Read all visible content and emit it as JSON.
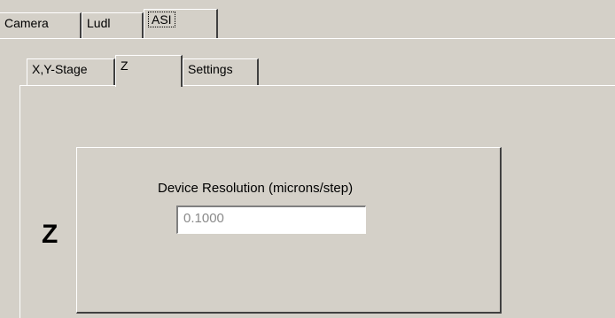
{
  "top_tabs": [
    {
      "label": "Camera"
    },
    {
      "label": "Ludl"
    },
    {
      "label": "ASI",
      "selected": true
    }
  ],
  "sub_tabs": [
    {
      "label": "X,Y-Stage"
    },
    {
      "label": "Z",
      "selected": true
    },
    {
      "label": "Settings"
    }
  ],
  "z_panel": {
    "axis_label": "Z",
    "resolution_label": "Device Resolution (microns/step)",
    "resolution_value": "0.1000"
  },
  "colors": {
    "background": "#d4d0c8",
    "highlight": "#ffffff",
    "shadow": "#404040",
    "disabled_text": "#8a8a8a"
  }
}
